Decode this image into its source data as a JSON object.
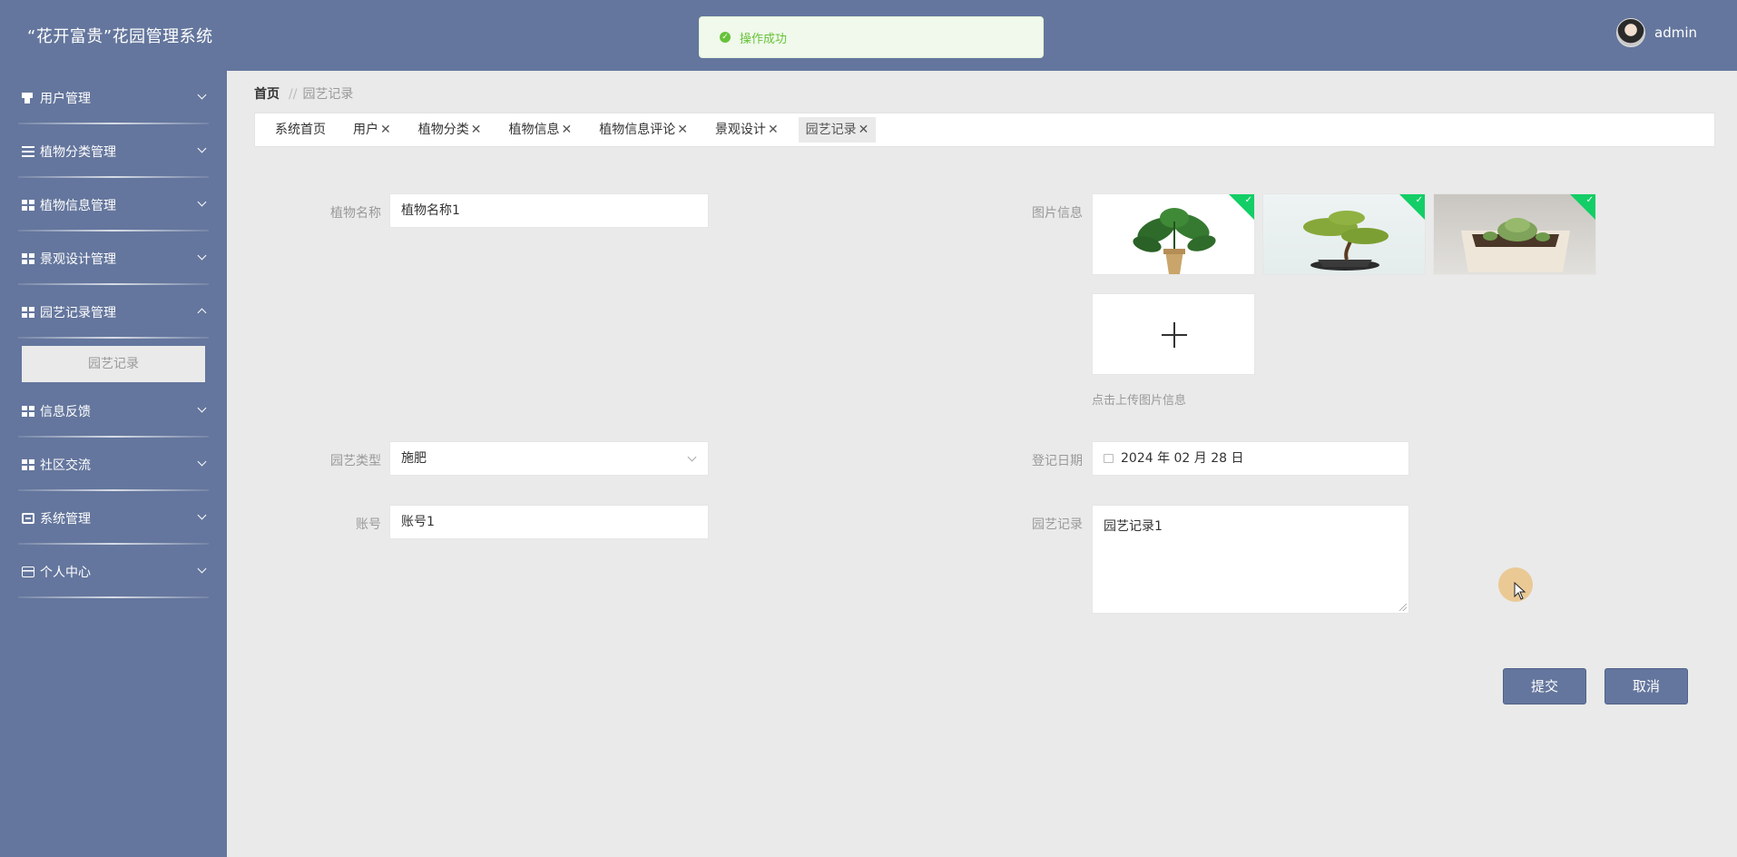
{
  "header": {
    "title": "“花开富贵”花园管理系统",
    "username": "admin"
  },
  "toast": {
    "message": "操作成功"
  },
  "sidebar": {
    "items": [
      {
        "label": "用户管理",
        "icon": "user-icon",
        "expanded": false
      },
      {
        "label": "植物分类管理",
        "icon": "list-icon",
        "expanded": false
      },
      {
        "label": "植物信息管理",
        "icon": "grid-icon",
        "expanded": false
      },
      {
        "label": "景观设计管理",
        "icon": "grid-icon",
        "expanded": false
      },
      {
        "label": "园艺记录管理",
        "icon": "grid-icon",
        "expanded": true,
        "children": [
          "园艺记录"
        ]
      },
      {
        "label": "信息反馈",
        "icon": "grid-icon",
        "expanded": false
      },
      {
        "label": "社区交流",
        "icon": "grid-icon",
        "expanded": false
      },
      {
        "label": "系统管理",
        "icon": "chat-icon",
        "expanded": false
      },
      {
        "label": "个人中心",
        "icon": "card-icon",
        "expanded": false
      }
    ]
  },
  "breadcrumb": {
    "home": "首页",
    "separator": "//",
    "current": "园艺记录"
  },
  "tags": [
    {
      "label": "系统首页",
      "closable": false,
      "active": false
    },
    {
      "label": "用户",
      "closable": true,
      "active": false
    },
    {
      "label": "植物分类",
      "closable": true,
      "active": false
    },
    {
      "label": "植物信息",
      "closable": true,
      "active": false
    },
    {
      "label": "植物信息评论",
      "closable": true,
      "active": false
    },
    {
      "label": "景观设计",
      "closable": true,
      "active": false
    },
    {
      "label": "园艺记录",
      "closable": true,
      "active": true
    }
  ],
  "form": {
    "plant_name": {
      "label": "植物名称",
      "value": "植物名称1"
    },
    "images": {
      "label": "图片信息",
      "upload_tip": "点击上传图片信息",
      "count": 3
    },
    "garden_type": {
      "label": "园艺类型",
      "value": "施肥"
    },
    "register_date": {
      "label": "登记日期",
      "value": "2024 年 02 月 28 日"
    },
    "account": {
      "label": "账号",
      "value": "账号1"
    },
    "record": {
      "label": "园艺记录",
      "value": "园艺记录1"
    }
  },
  "buttons": {
    "submit": "提交",
    "cancel": "取消"
  },
  "colors": {
    "primary": "#64769d",
    "success": "#67c23a",
    "upload_badge": "#13ce66",
    "page_bg": "#eaeaea"
  }
}
